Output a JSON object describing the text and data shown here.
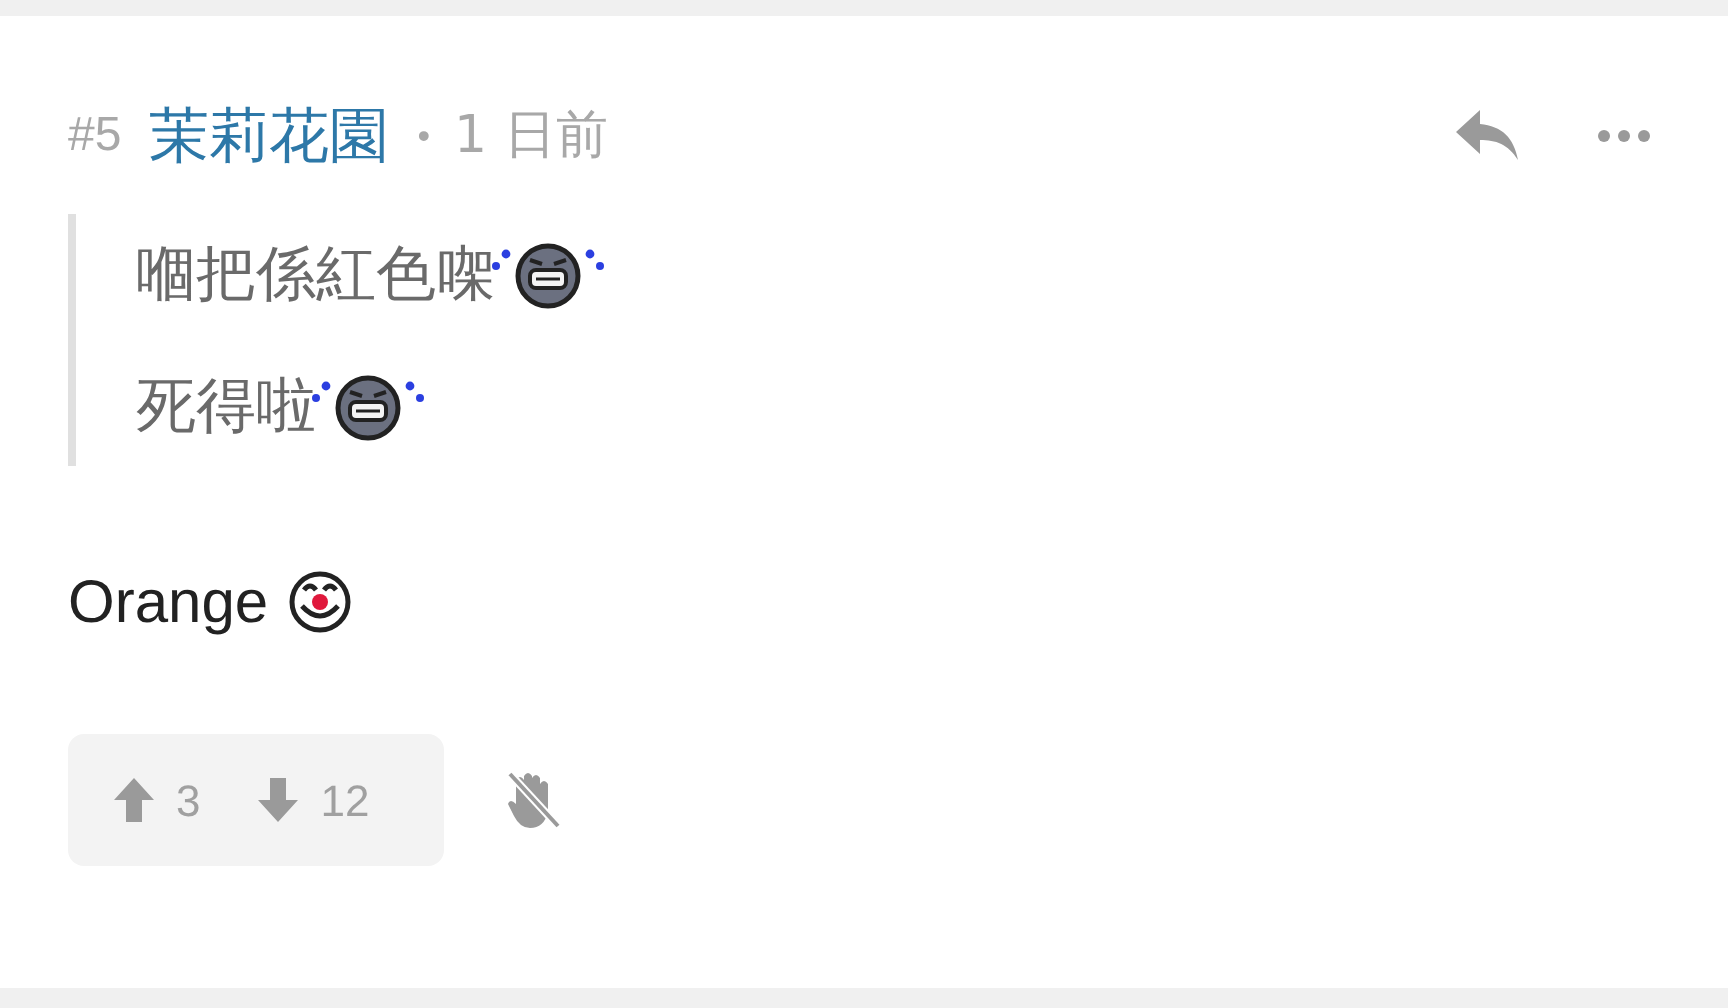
{
  "post": {
    "number": "#5",
    "author": "茉莉花園",
    "separator": "•",
    "time": "1 日前"
  },
  "quote": [
    "嗰把係紅色㗎",
    "死得啦"
  ],
  "body": "Orange",
  "votes": {
    "up": "3",
    "down": "12"
  }
}
